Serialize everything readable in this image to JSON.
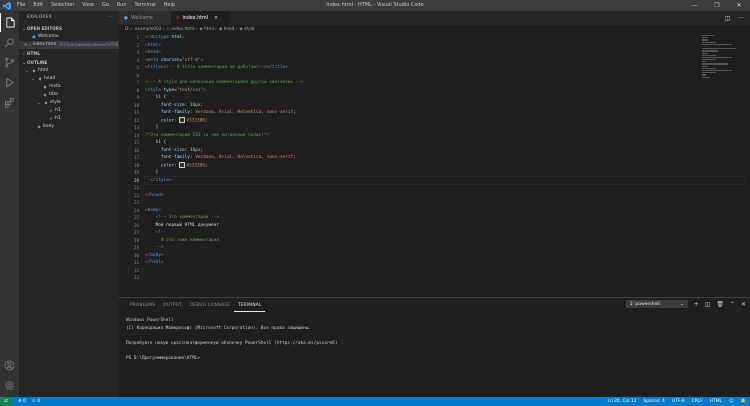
{
  "window": {
    "title": "index.html - HTML - Visual Studio Code",
    "controls": [
      "—",
      "❐",
      "✕"
    ]
  },
  "menu": [
    "File",
    "Edit",
    "Selection",
    "View",
    "Go",
    "Run",
    "Terminal",
    "Help"
  ],
  "sidebar": {
    "title": "EXPLORER",
    "open_editors": {
      "label": "OPEN EDITORS",
      "items": [
        {
          "icon": "info",
          "name": "Welcome",
          "path": ""
        },
        {
          "icon": "html",
          "name": "index.html",
          "path": "D:\\Программирование\\HTML\\example002"
        }
      ]
    },
    "html_section": "HTML",
    "outline": {
      "label": "OUTLINE",
      "items": [
        "html",
        "head",
        "meta",
        "title",
        "style",
        "h1",
        "h1",
        "body"
      ]
    }
  },
  "tabs": [
    {
      "label": "Welcome",
      "active": false
    },
    {
      "label": "index.html",
      "active": true
    }
  ],
  "breadcrumb": [
    "D:",
    "example002",
    "index.html",
    "html",
    "head",
    "style"
  ],
  "editor": {
    "current_line": 20
  },
  "panel": {
    "tabs": [
      "PROBLEMS",
      "OUTPUT",
      "DEBUG CONSOLE",
      "TERMINAL"
    ],
    "active_tab": "TERMINAL",
    "terminal_select": "1: powershell",
    "terminal_lines": [
      "Windows PowerShell",
      "(С) Корпорация Майкрософт (Microsoft Corporation). Все права защищены.",
      "",
      "Попробуйте новую кроссплатформенную оболочку PowerShell (https://aka.ms/pscore6)",
      "",
      "PS D:\\Программирование\\HTML>"
    ]
  },
  "status": {
    "errors": "⊗ 0",
    "warnings": "⚠ 0",
    "position": "Ln 20, Col 12",
    "spaces": "Spaces: 4",
    "encoding": "UTF-8",
    "eol": "CRLF",
    "language": "HTML"
  },
  "colors": {
    "status": "#007acc",
    "activity": "#333333",
    "sidebar": "#252526",
    "editor": "#1e1e1e"
  }
}
